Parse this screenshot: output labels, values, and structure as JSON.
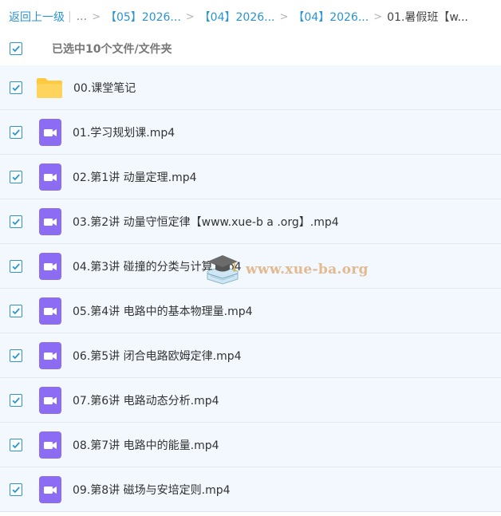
{
  "breadcrumb": {
    "back": "返回上一级",
    "pipe": "|",
    "ellipsis": "...",
    "sep": ">",
    "items": [
      "【05】2026...",
      "【04】2026...",
      "【04】2026..."
    ],
    "current": "01.暑假班【w..."
  },
  "selection": {
    "text": "已选中10个文件/文件夹",
    "checked": true
  },
  "files": [
    {
      "name": "00.课堂笔记",
      "type": "folder",
      "checked": true
    },
    {
      "name": "01.学习规划课.mp4",
      "type": "video",
      "checked": true
    },
    {
      "name": "02.第1讲 动量定理.mp4",
      "type": "video",
      "checked": true
    },
    {
      "name": "03.第2讲 动量守恒定律【www.xue-b a .org】.mp4",
      "type": "video",
      "checked": true
    },
    {
      "name": "04.第3讲 碰撞的分类与计算.mp4",
      "type": "video",
      "checked": true
    },
    {
      "name": "05.第4讲 电路中的基本物理量.mp4",
      "type": "video",
      "checked": true
    },
    {
      "name": "06.第5讲 闭合电路欧姆定律.mp4",
      "type": "video",
      "checked": true
    },
    {
      "name": "07.第6讲 电路动态分析.mp4",
      "type": "video",
      "checked": true
    },
    {
      "name": "08.第7讲 电路中的能量.mp4",
      "type": "video",
      "checked": true
    },
    {
      "name": "09.第8讲 磁场与安培定则.mp4",
      "type": "video",
      "checked": true
    }
  ],
  "watermark": {
    "text": "www.xue-ba.org"
  },
  "colors": {
    "link": "#2b94d4",
    "row_bg": "#f2f8fd",
    "video_icon": "#8b6cf2",
    "folder_icon": "#ffc940",
    "watermark": "#e3b98f"
  },
  "icons": {
    "checkbox": "check-icon",
    "video": "video-file-icon",
    "folder": "folder-icon",
    "watermark": "graduation-cap-book-icon"
  }
}
